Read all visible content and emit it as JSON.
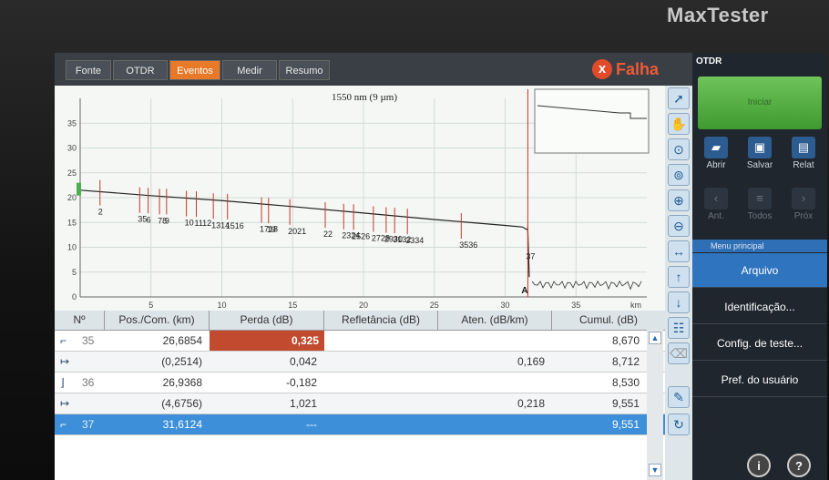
{
  "brand": "MaxTester",
  "tabs": [
    "Fonte",
    "OTDR",
    "Eventos",
    "Medir",
    "Resumo"
  ],
  "active_tab": "Eventos",
  "status": {
    "icon": "x",
    "label": "Falha"
  },
  "chart_data": {
    "type": "line",
    "title": "1550 nm (9 µm)",
    "xunit": "km",
    "xlim": [
      0,
      40
    ],
    "ylim": [
      0,
      40
    ],
    "xticks": [
      5,
      10,
      15,
      20,
      25,
      30,
      35
    ],
    "yticks": [
      0,
      5,
      10,
      15,
      20,
      25,
      30,
      35
    ],
    "trace": [
      [
        0,
        21.5
      ],
      [
        5,
        20.4
      ],
      [
        10,
        19.4
      ],
      [
        15,
        18.2
      ],
      [
        20,
        16.9
      ],
      [
        25,
        15.6
      ],
      [
        30,
        14.4
      ],
      [
        31.2,
        14.1
      ],
      [
        31.6,
        13.5
      ],
      [
        31.7,
        4
      ]
    ],
    "events": [
      {
        "label": "2",
        "x": 1.4,
        "y": 21
      },
      {
        "label": "35",
        "x": 4.2,
        "y": 19.5
      },
      {
        "label": "6",
        "x": 4.8,
        "y": 19.4
      },
      {
        "label": "78",
        "x": 5.6,
        "y": 19.2
      },
      {
        "label": "9",
        "x": 6.1,
        "y": 19.2
      },
      {
        "label": "10",
        "x": 7.5,
        "y": 18.8
      },
      {
        "label": "1112",
        "x": 8.2,
        "y": 18.7
      },
      {
        "label": "1314",
        "x": 9.4,
        "y": 18.3
      },
      {
        "label": "1516",
        "x": 10.4,
        "y": 18.2
      },
      {
        "label": "1718",
        "x": 12.8,
        "y": 17.5
      },
      {
        "label": "19",
        "x": 13.3,
        "y": 17.4
      },
      {
        "label": "2021",
        "x": 14.8,
        "y": 17.1
      },
      {
        "label": "22",
        "x": 17.3,
        "y": 16.5
      },
      {
        "label": "2324",
        "x": 18.6,
        "y": 16.2
      },
      {
        "label": "2526",
        "x": 19.3,
        "y": 16.1
      },
      {
        "label": "2728",
        "x": 20.7,
        "y": 15.7
      },
      {
        "label": "2930",
        "x": 21.6,
        "y": 15.5
      },
      {
        "label": "3132",
        "x": 22.2,
        "y": 15.4
      },
      {
        "label": "3334",
        "x": 23.1,
        "y": 15.2
      },
      {
        "label": "3536",
        "x": 26.9,
        "y": 14.3
      },
      {
        "label": "37",
        "x": 31.6,
        "y": 12
      }
    ],
    "end_marker": "A"
  },
  "table": {
    "columns": [
      "Nº",
      "Pos./Com. (km)",
      "Perda (dB)",
      "Refletância (dB)",
      "Aten. (dB/km)",
      "Cumul. (dB)"
    ],
    "rows": [
      {
        "icon": "reflective-event-icon",
        "glyph": "⌐",
        "no": "35",
        "pos": "26,6854",
        "loss": "0,325",
        "refl": "",
        "aten": "",
        "cumul": "8,670",
        "hl": true
      },
      {
        "icon": "fiber-section-icon",
        "glyph": "↦",
        "no": "",
        "pos": "(0,2514)",
        "loss": "0,042",
        "refl": "",
        "aten": "0,169",
        "cumul": "8,712"
      },
      {
        "icon": "nonreflective-event-icon",
        "glyph": "⌋",
        "no": "36",
        "pos": "26,9368",
        "loss": "-0,182",
        "refl": "",
        "aten": "",
        "cumul": "8,530"
      },
      {
        "icon": "fiber-section-icon",
        "glyph": "↦",
        "no": "",
        "pos": "(4,6756)",
        "loss": "1,021",
        "refl": "",
        "aten": "0,218",
        "cumul": "9,551"
      },
      {
        "icon": "reflective-event-icon",
        "glyph": "⌐",
        "no": "37",
        "pos": "31,6124",
        "loss": "---",
        "refl": "",
        "aten": "",
        "cumul": "9,551",
        "sel": true
      }
    ]
  },
  "panel": {
    "title": "OTDR",
    "start_label": "Iniciar",
    "buttons": [
      {
        "label": "Abrir",
        "icon": "open-folder-icon",
        "glyph": "▰"
      },
      {
        "label": "Salvar",
        "icon": "save-icon",
        "glyph": "▣"
      },
      {
        "label": "Relat",
        "icon": "report-icon",
        "glyph": "▤"
      }
    ],
    "nav_buttons": [
      {
        "label": "Ant.",
        "icon": "previous-icon",
        "glyph": "‹"
      },
      {
        "label": "Todos",
        "icon": "all-icon",
        "glyph": "≡"
      },
      {
        "label": "Próx",
        "icon": "next-icon",
        "glyph": "›"
      }
    ],
    "menu_header": "Menu principal",
    "menu": [
      "Arquivo",
      "Identificação...",
      "Config. de teste...",
      "Pref. do usuário"
    ]
  }
}
